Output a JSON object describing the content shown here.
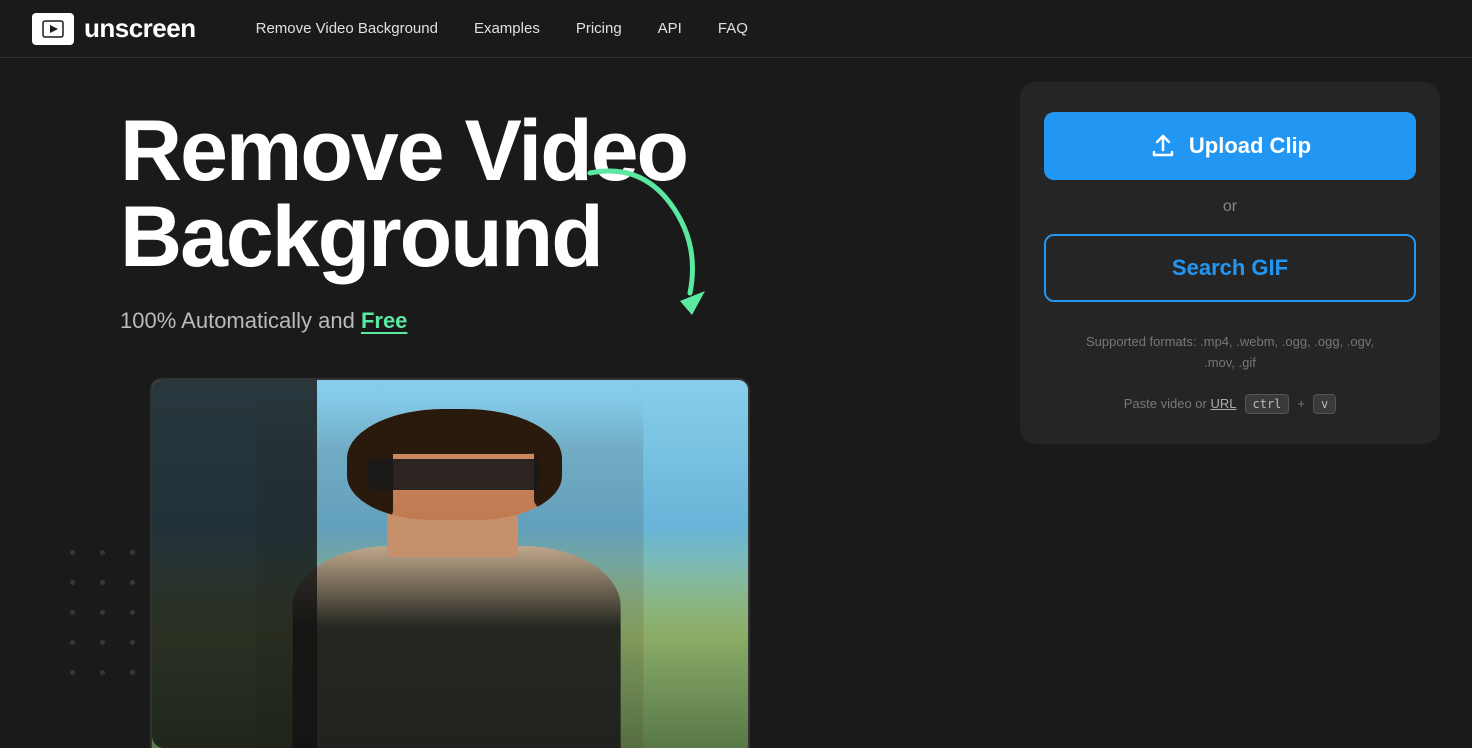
{
  "nav": {
    "logo_text": "unscreen",
    "links": [
      {
        "label": "Remove Video Background",
        "href": "#"
      },
      {
        "label": "Examples",
        "href": "#"
      },
      {
        "label": "Pricing",
        "href": "#"
      },
      {
        "label": "API",
        "href": "#"
      },
      {
        "label": "FAQ",
        "href": "#"
      }
    ]
  },
  "hero": {
    "title_line1": "Remove Video",
    "title_line2": "Background",
    "subtitle_plain": "100% Automatically and ",
    "subtitle_highlight": "Free"
  },
  "panel": {
    "upload_btn_label": "Upload Clip",
    "or_label": "or",
    "search_gif_label": "Search GIF",
    "supported_label": "Supported formats: .mp4, .webm, .ogg, .ogg, .ogv,",
    "supported_label2": ".mov, .gif",
    "paste_label": "Paste video or URL",
    "kbd_ctrl": "ctrl",
    "kbd_v": "v",
    "plus": "+"
  }
}
